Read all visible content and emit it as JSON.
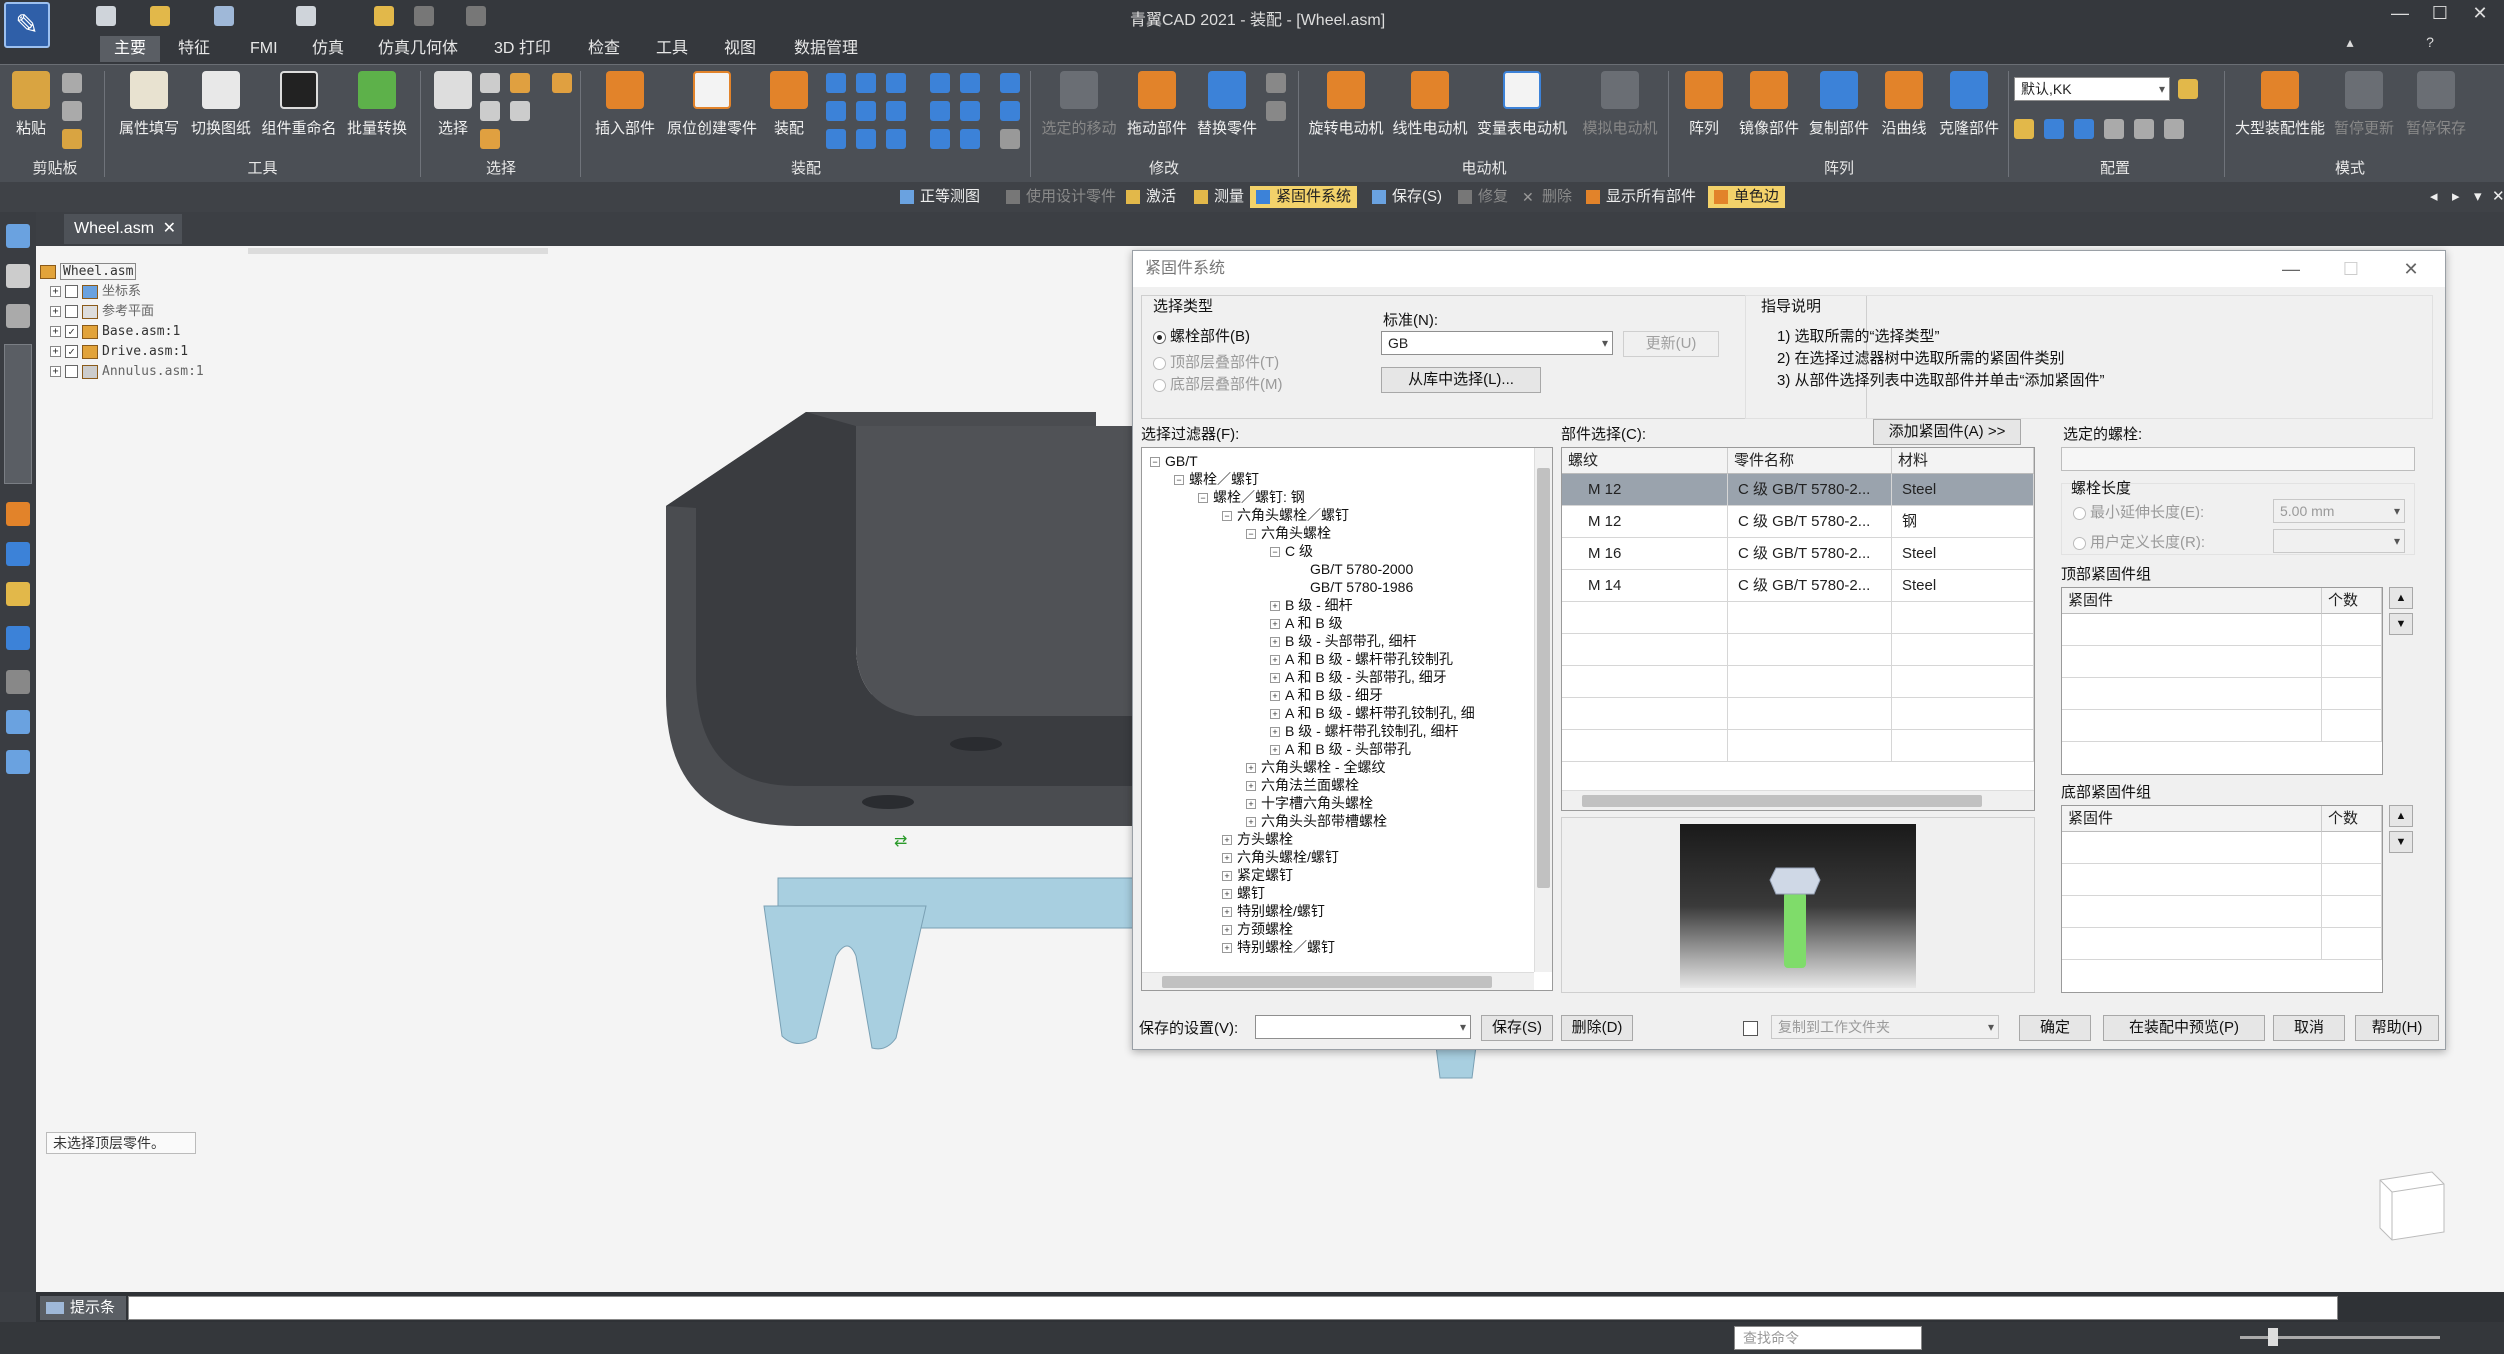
{
  "app": {
    "window_title": "青翼CAD 2021 - 装配 - [Wheel.asm]"
  },
  "menu_tabs": [
    "主要",
    "特征",
    "FMI",
    "仿真",
    "仿真几何体",
    "3D 打印",
    "检查",
    "工具",
    "视图",
    "数据管理"
  ],
  "ribbon": {
    "clipboard": {
      "paste": "粘贴",
      "group": "剪贴板"
    },
    "tools": {
      "fill_props": "属性填写",
      "switch_drawing": "切换图纸",
      "rename": "组件重命名",
      "batch_convert": "批量转换",
      "group": "工具"
    },
    "select": {
      "select": "选择",
      "group": "选择"
    },
    "assembly": {
      "insert": "插入部件",
      "create_in_place": "原位创建零件",
      "assemble": "装配",
      "group": "装配"
    },
    "modify": {
      "move_selected": "选定的移动",
      "drag": "拖动部件",
      "replace": "替换零件",
      "group": "修改"
    },
    "motor": {
      "rotary": "旋转电动机",
      "linear": "线性电动机",
      "variable": "变量表电动机",
      "simulate": "模拟电动机",
      "group": "电动机"
    },
    "array": {
      "array": "阵列",
      "mirror": "镜像部件",
      "copy": "复制部件",
      "curve": "沿曲线",
      "clone": "克隆部件",
      "group": "阵列"
    },
    "config": {
      "combo_value": "默认,KK",
      "group": "配置"
    },
    "mode": {
      "large_assembly": "大型装配性能",
      "pause_update": "暂停更新",
      "pause_save": "暂停保存",
      "group": "模式"
    }
  },
  "context_bar": {
    "iso_view": "正等测图",
    "design_parts": "使用设计零件",
    "activate": "激活",
    "measure": "测量",
    "fastener_system": "紧固件系统",
    "save": "保存(S)",
    "repair": "修复",
    "delete": "删除",
    "show_all": "显示所有部件",
    "mono": "单色边"
  },
  "doc_tab": "Wheel.asm",
  "model_tree": {
    "root": "Wheel.asm",
    "items": [
      "坐标系",
      "参考平面",
      "Base.asm:1",
      "Drive.asm:1",
      "Annulus.asm:1"
    ]
  },
  "canvas_status": "未选择顶层零件。",
  "prompt_bar": {
    "label": "提示条"
  },
  "status_bar": {
    "search_placeholder": "查找命令"
  },
  "dialog": {
    "title": "紧固件系统",
    "select_type": {
      "label": "选择类型",
      "options": [
        "螺栓部件(B)",
        "顶部层叠部件(T)",
        "底部层叠部件(M)"
      ]
    },
    "standard_label": "标准(N):",
    "standard_value": "GB",
    "update_button": "更新(U)",
    "from_library_button": "从库中选择(L)...",
    "guide": {
      "label": "指导说明",
      "lines": [
        "1) 选取所需的“选择类型”",
        "2) 在选择过滤器树中选取所需的紧固件类别",
        "3) 从部件选择列表中选取部件并单击“添加紧固件”"
      ]
    },
    "filter_label": "选择过滤器(F):",
    "filter_tree": [
      "GB/T",
      "螺栓／螺钉",
      "螺栓／螺钉: 钢",
      "六角头螺栓／螺钉",
      "六角头螺栓",
      "C 级",
      "GB/T 5780-2000",
      "GB/T 5780-1986",
      "B 级 - 细杆",
      "A 和 B 级",
      "B 级 - 头部带孔, 细杆",
      "A 和 B 级 - 螺杆带孔铰制孔",
      "A 和 B 级 - 头部带孔, 细牙",
      "A 和 B 级 - 细牙",
      "A 和 B 级 - 螺杆带孔铰制孔, 细",
      "B 级 - 螺杆带孔铰制孔, 细杆",
      "A 和 B 级 - 头部带孔",
      "六角头螺栓 - 全螺纹",
      "六角法兰面螺栓",
      "十字槽六角头螺栓",
      "六角头头部带槽螺栓",
      "方头螺栓",
      "六角头螺栓/螺钉",
      "紧定螺钉",
      "螺钉",
      "特别螺栓/螺钉",
      "方颈螺栓",
      "特别螺栓／螺钉"
    ],
    "part_select_label": "部件选择(C):",
    "add_fastener_button": "添加紧固件(A) >>",
    "parts_table": {
      "headers": [
        "螺纹",
        "零件名称",
        "材料"
      ],
      "rows": [
        [
          "M 12",
          "C 级 GB/T 5780-2...",
          "Steel"
        ],
        [
          "M 12",
          "C 级 GB/T 5780-2...",
          "钢"
        ],
        [
          "M 16",
          "C 级 GB/T 5780-2...",
          "Steel"
        ],
        [
          "M 14",
          "C 级 GB/T 5780-2...",
          "Steel"
        ]
      ]
    },
    "selected_bolt_label": "选定的螺栓:",
    "bolt_length": {
      "label": "螺栓长度",
      "min_extension": "最小延伸长度(E):",
      "min_value": "5.00 mm",
      "user_defined": "用户定义长度(R):"
    },
    "top_group": {
      "label": "顶部紧固件组",
      "col_fastener": "紧固件",
      "col_count": "个数"
    },
    "bottom_group": {
      "label": "底部紧固件组",
      "col_fastener": "紧固件",
      "col_count": "个数"
    },
    "saved_settings_label": "保存的设置(V):",
    "save_button": "保存(S)",
    "delete_button": "删除(D)",
    "copy_to_workdir": "复制到工作文件夹",
    "ok_button": "确定",
    "preview_button": "在装配中预览(P)",
    "cancel_button": "取消",
    "help_button": "帮助(H)"
  }
}
